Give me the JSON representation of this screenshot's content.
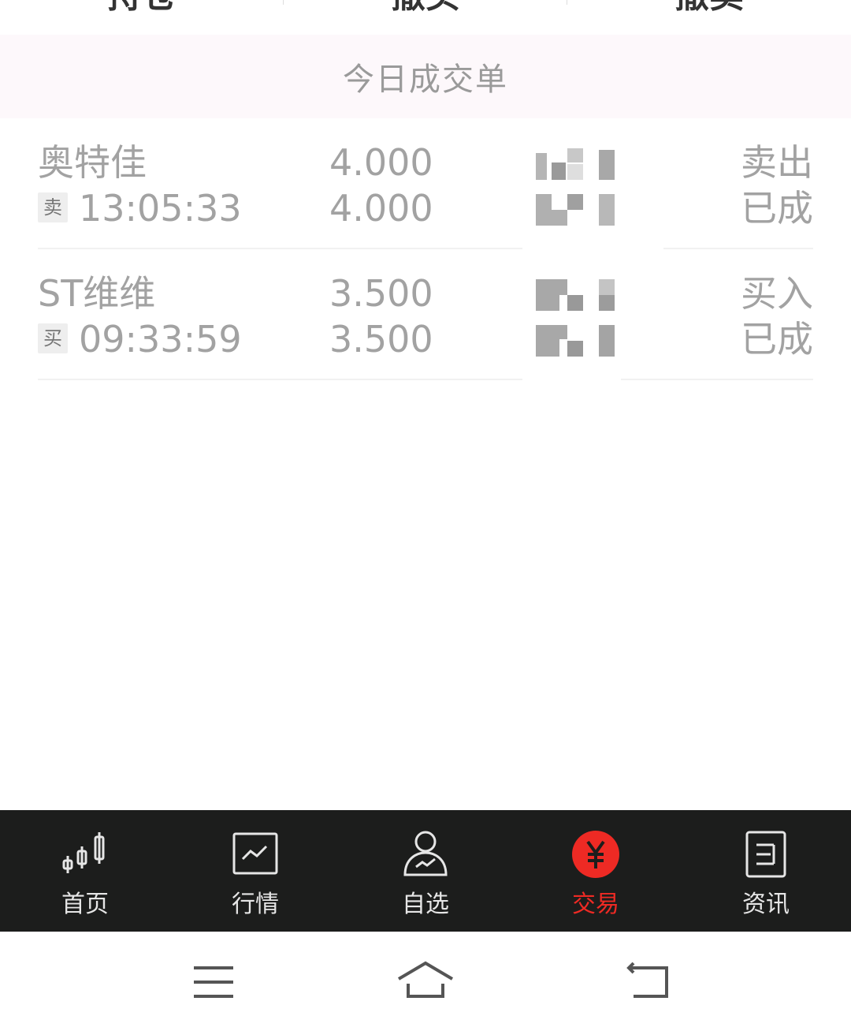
{
  "top_tabs": [
    "持仓",
    "撤买",
    "撤卖"
  ],
  "section_title": "今日成交单",
  "trades": [
    {
      "name": "奥特佳",
      "side_badge": "卖",
      "time": "13:05:33",
      "price": "4.000",
      "deal_price": "4.000",
      "direction": "卖出",
      "state": "已成"
    },
    {
      "name": "ST维维",
      "side_badge": "买",
      "time": "09:33:59",
      "price": "3.500",
      "deal_price": "3.500",
      "direction": "买入",
      "state": "已成"
    }
  ],
  "nav": [
    {
      "label": "首页",
      "icon": "candlestick-icon"
    },
    {
      "label": "行情",
      "icon": "market-chart-icon"
    },
    {
      "label": "自选",
      "icon": "user-chart-icon"
    },
    {
      "label": "交易",
      "icon": "yen-icon",
      "active": true
    },
    {
      "label": "资讯",
      "icon": "news-doc-icon"
    }
  ],
  "colors": {
    "accent": "#ee2a24",
    "nav_bg": "#1c1d1c",
    "muted_text": "#a2a2a2",
    "header_bg": "#fdf8fb"
  }
}
